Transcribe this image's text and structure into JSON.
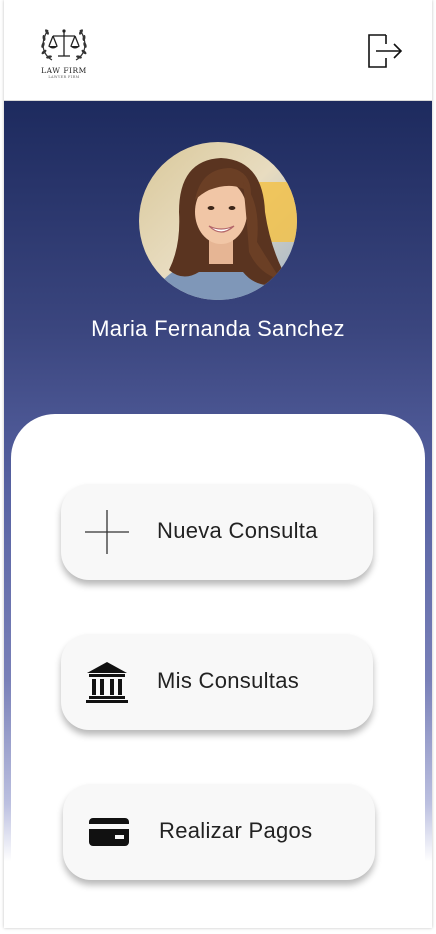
{
  "header": {
    "logo_text": "LAW FIRM",
    "logo_subtext": "LAWYER FIRM",
    "logout_icon": "logout-icon"
  },
  "profile": {
    "name": "Maria Fernanda Sanchez"
  },
  "menu": {
    "items": [
      {
        "label": "Nueva Consulta",
        "icon": "plus-icon"
      },
      {
        "label": "Mis Consultas",
        "icon": "bank-icon"
      },
      {
        "label": "Realizar Pagos",
        "icon": "credit-card-icon"
      }
    ]
  },
  "colors": {
    "gradient_top": "#1d2a5e",
    "gradient_mid": "#5863a3",
    "card_bg": "#ffffff",
    "button_bg": "#f8f8f8"
  }
}
